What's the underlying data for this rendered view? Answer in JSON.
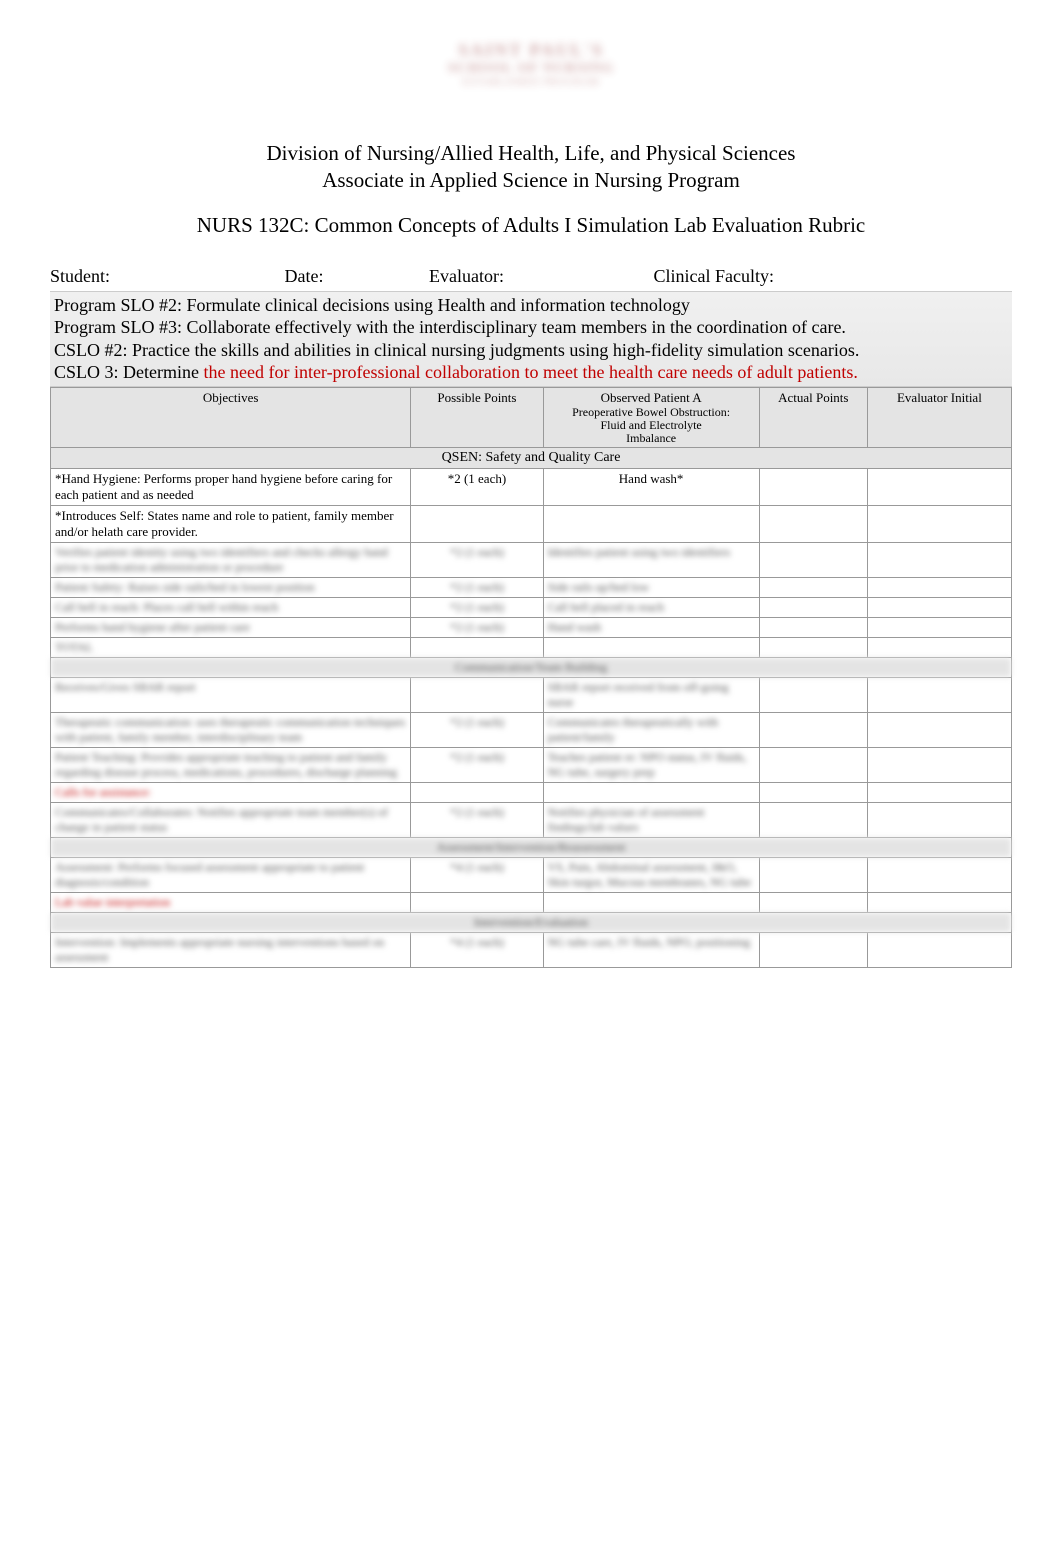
{
  "logo": {
    "line1": "SAINT PAUL'S",
    "line2": "SCHOOL OF NURSING",
    "line3": "ESTABLISHED PROGRAM"
  },
  "header": {
    "line1": "Division of Nursing/Allied Health, Life, and Physical Sciences",
    "line2": "Associate in Applied Science in Nursing Program",
    "course": "NURS 132C: Common Concepts of Adults I Simulation Lab Evaluation Rubric"
  },
  "info": {
    "student_label": "Student:",
    "date_label": "Date:",
    "evaluator_label": "Evaluator:",
    "clinical_faculty_label": "Clinical Faculty:"
  },
  "slo": {
    "p2": "Program SLO #2: Formulate clinical decisions using Health and information technology",
    "p3": "Program SLO #3: Collaborate effectively with the interdisciplinary team members in the coordination of care.",
    "c2": "CSLO #2: Practice the skills and abilities in clinical nursing judgments using high-fidelity simulation scenarios.",
    "c3_a": "CSLO 3: Determine",
    "c3_b": "   the need for inter-professional collaboration to meet the health care needs of adult patients."
  },
  "columns": {
    "objectives": "Objectives",
    "possible": "Possible Points",
    "observed_title": "Observed Patient A",
    "observed_sub1": "Preoperative Bowel Obstruction:",
    "observed_sub2": "Fluid and Electrolyte",
    "observed_sub3": "Imbalance",
    "actual": "Actual Points",
    "initial": "Evaluator Initial"
  },
  "sections": {
    "qsen_safety": "QSEN: Safety and Quality Care",
    "comm": "Communication/Team Building",
    "assess": "Assessment/Intervention/Reassessment"
  },
  "rows": {
    "r1_obj": "*Hand Hygiene:   Performs proper hand hygiene before caring for each patient and as needed",
    "r1_pts": "*2 (1 each)",
    "r1_obs": "Hand wash*",
    "r2_obj": "*Introduces Self:  States name and role to patient, family member and/or helath care provider.",
    "r2_pts": "",
    "r2_obs": "",
    "b1_obj": "Verifies patient identity using two identifiers and checks allergy band prior to medication administration or procedure",
    "b1_pts": "*2 (1 each)",
    "b1_obs": "Identifies patient using two identifiers",
    "b2_obj": "Patient Safety: Raises side rails/bed in lowest position",
    "b2_pts": "*2 (1 each)",
    "b2_obs": "Side rails up/bed low",
    "b3_obj": "Call bell in reach: Places call bell within reach",
    "b3_pts": "*2 (1 each)",
    "b3_obs": "Call bell placed in reach",
    "b4_obj": "Performs hand hygiene after patient care",
    "b4_pts": "*2 (1 each)",
    "b4_obs": "Hand wash",
    "b5_obj": "TOTAL",
    "c1_obj": "Receives/Gives SBAR report",
    "c1_pts": "",
    "c1_obs": "SBAR report received from off-going nurse",
    "c2_obj": "Therapeutic communication: uses therapeutic communication techniques with patient, family member, interdisciplinary team",
    "c2_pts": "*2 (1 each)",
    "c2_obs": "Communicates therapeutically with patient/family",
    "c3_obj": "Patient Teaching: Provides appropriate teaching to patient and family regarding disease process, medications, procedures, discharge planning",
    "c3_pts": "*2 (1 each)",
    "c3_obs": "Teaches patient re: NPO status, IV fluids, NG tube, surgery prep",
    "c4_obj": "Calls for assistance:",
    "c5_obj": "Communicates/Collaborates: Notifies appropriate team member(s) of change in patient status",
    "c5_pts": "*2 (1 each)",
    "c5_obs": "Notifies physician of assessment findings/lab values",
    "d1_obj": "Assessment: Performs focused assessment appropriate to patient diagnosis/condition",
    "d1_pts": "*4 (1 each)",
    "d1_obs": "VS, Pain, Abdominal assessment, I&O, Skin turgor, Mucous membranes, NG tube",
    "d2_obj": "Lab value interpretation",
    "e1_obj": "Intervention: Implements appropriate nursing interventions based on assessment",
    "e1_pts": "*4 (1 each)",
    "e1_obs": "NG tube care, IV fluids, NPO, positioning"
  }
}
